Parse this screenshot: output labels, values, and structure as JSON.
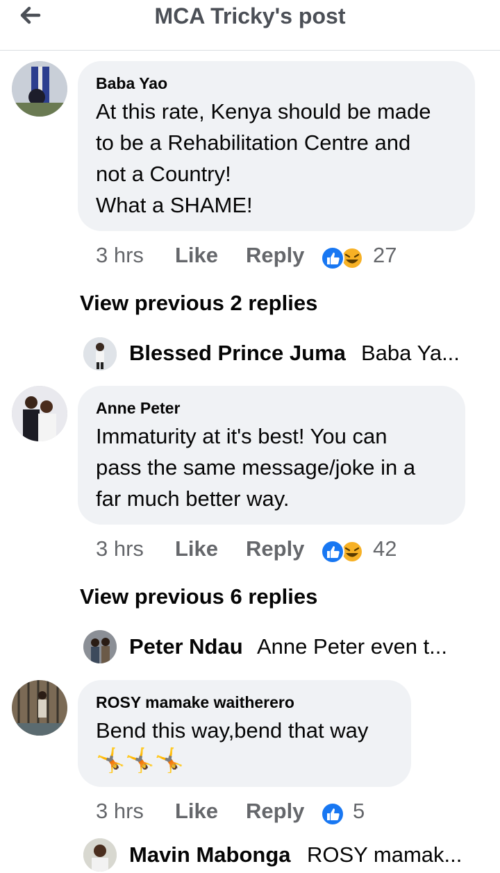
{
  "header": {
    "title": "MCA Tricky's post",
    "back_icon": "arrow-left-icon"
  },
  "colors": {
    "like_blue": "#1877f2",
    "haha_yellow": "#f7b125",
    "bubble_bg": "#f0f2f5",
    "meta_gray": "#65676b"
  },
  "comments": [
    {
      "author": "Baba Yao",
      "text": "At this rate, Kenya should be made\nto be a Rehabilitation Centre and\nnot a Country!\nWhat a SHAME!",
      "time": "3 hrs",
      "like_label": "Like",
      "reply_label": "Reply",
      "reactions": [
        "like-icon",
        "haha-icon"
      ],
      "reaction_count": "27",
      "view_previous": "View previous 2 replies",
      "reply_preview": {
        "name": "Blessed Prince Juma",
        "snippet": "Baba Ya..."
      }
    },
    {
      "author": "Anne Peter",
      "text": "Immaturity at it's best! You can\npass the same message/joke in a\nfar much better way.",
      "time": "3 hrs",
      "like_label": "Like",
      "reply_label": "Reply",
      "reactions": [
        "like-icon",
        "haha-icon"
      ],
      "reaction_count": "42",
      "view_previous": "View previous 6 replies",
      "reply_preview": {
        "name": "Peter Ndau",
        "snippet": "Anne Peter even t..."
      }
    },
    {
      "author": "ROSY mamake waitherero",
      "text": "Bend this way,bend that way",
      "emojis": "🤸🤸🤸",
      "time": "3 hrs",
      "like_label": "Like",
      "reply_label": "Reply",
      "reactions": [
        "like-icon"
      ],
      "reaction_count": "5",
      "reply_preview": {
        "name": "Mavin Mabonga",
        "snippet": "ROSY mamak..."
      }
    }
  ]
}
